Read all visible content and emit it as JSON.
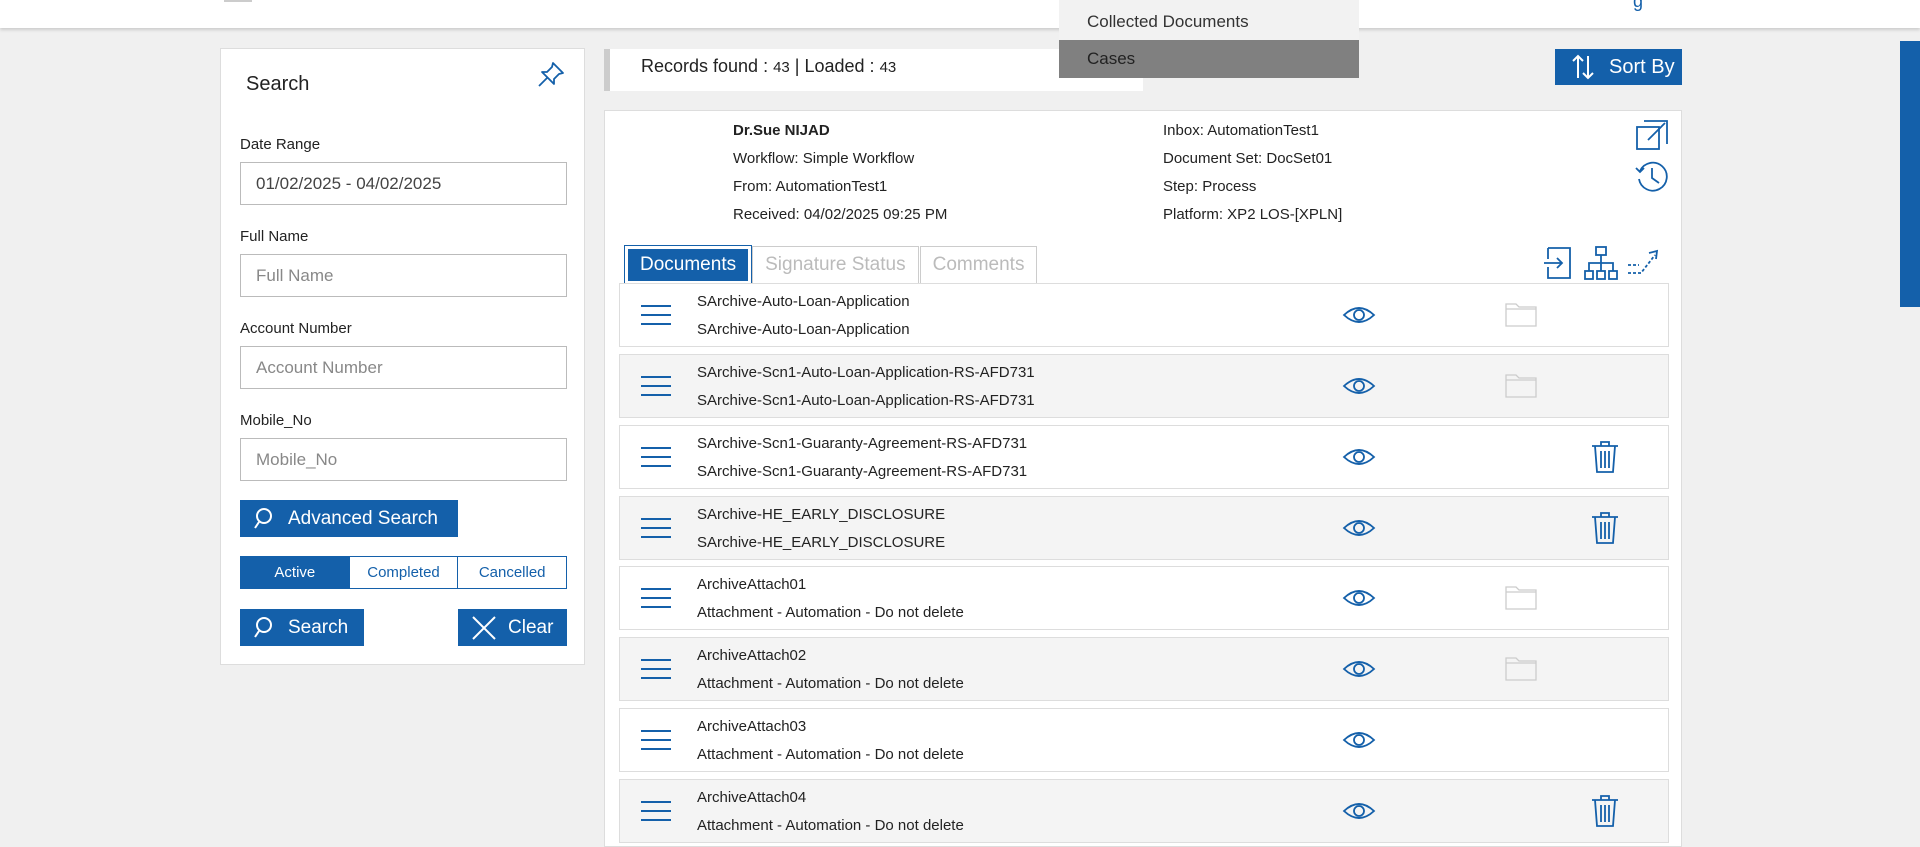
{
  "topbar": {
    "partial_text": "g"
  },
  "dropdown": {
    "items": [
      "Collected Documents",
      "Cases"
    ]
  },
  "search_panel": {
    "title": "Search",
    "date_range": {
      "label": "Date Range",
      "value": "01/02/2025 - 04/02/2025"
    },
    "full_name": {
      "label": "Full Name",
      "placeholder": "Full Name"
    },
    "account_number": {
      "label": "Account Number",
      "placeholder": "Account Number"
    },
    "mobile_no": {
      "label": "Mobile_No",
      "placeholder": "Mobile_No"
    },
    "advanced_search_label": "Advanced Search",
    "status_filters": [
      "Active",
      "Completed",
      "Cancelled"
    ],
    "active_filter": "Active",
    "search_label": "Search",
    "clear_label": "Clear"
  },
  "records": {
    "found_label": "Records found :",
    "found": "43",
    "sep": "| Loaded :",
    "loaded": "43"
  },
  "sort_label": "Sort By",
  "detail": {
    "name": "Dr.Sue NIJAD",
    "workflow": "Workflow: Simple Workflow",
    "from": "From: AutomationTest1",
    "received": "Received: 04/02/2025 09:25 PM",
    "inbox": "Inbox: AutomationTest1",
    "document_set": "Document Set: DocSet01",
    "step": "Step: Process",
    "platform": "Platform: XP2 LOS-[XPLN]"
  },
  "tabs": [
    "Documents",
    "Signature Status",
    "Comments"
  ],
  "documents": [
    {
      "line1": "SArchive-Auto-Loan-Application",
      "line2": "SArchive-Auto-Loan-Application",
      "action": "folder"
    },
    {
      "line1": "SArchive-Scn1-Auto-Loan-Application-RS-AFD731",
      "line2": "SArchive-Scn1-Auto-Loan-Application-RS-AFD731",
      "action": "folder"
    },
    {
      "line1": "SArchive-Scn1-Guaranty-Agreement-RS-AFD731",
      "line2": "SArchive-Scn1-Guaranty-Agreement-RS-AFD731",
      "action": "trash"
    },
    {
      "line1": "SArchive-HE_EARLY_DISCLOSURE",
      "line2": "SArchive-HE_EARLY_DISCLOSURE",
      "action": "trash"
    },
    {
      "line1": "ArchiveAttach01",
      "line2": "Attachment - Automation - Do not delete",
      "action": "folder"
    },
    {
      "line1": "ArchiveAttach02",
      "line2": "Attachment - Automation - Do not delete",
      "action": "folder"
    },
    {
      "line1": "ArchiveAttach03",
      "line2": "Attachment - Automation - Do not delete",
      "action": "none"
    },
    {
      "line1": "ArchiveAttach04",
      "line2": "Attachment - Automation - Do not delete",
      "action": "trash"
    }
  ],
  "colors": {
    "accent": "#1460aa",
    "background": "#f0f0f0",
    "row_alt": "#f4f4f4"
  },
  "icons": [
    "pin-icon",
    "search-icon",
    "close-icon",
    "sort-icon",
    "open-external-icon",
    "history-icon",
    "export-icon",
    "hierarchy-icon",
    "route-icon",
    "menu-icon",
    "eye-icon",
    "folder-icon",
    "trash-icon"
  ]
}
